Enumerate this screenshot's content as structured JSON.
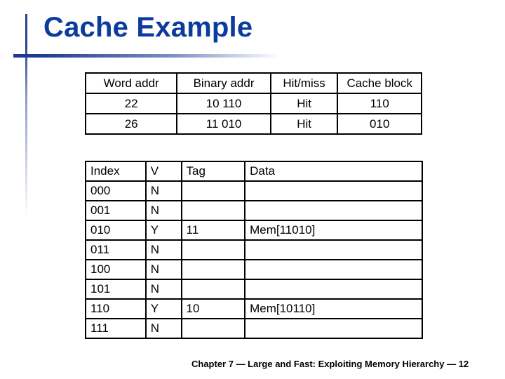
{
  "slide": {
    "title": "Cache Example",
    "footer": "Chapter 7 — Large and Fast: Exploiting Memory Hierarchy — 12"
  },
  "access_table": {
    "headers": [
      "Word addr",
      "Binary addr",
      "Hit/miss",
      "Cache block"
    ],
    "rows": [
      [
        "22",
        "10 110",
        "Hit",
        "110"
      ],
      [
        "26",
        "11 010",
        "Hit",
        "010"
      ]
    ]
  },
  "cache_table": {
    "headers": [
      "Index",
      "V",
      "Tag",
      "Data"
    ],
    "rows": [
      [
        "000",
        "N",
        "",
        ""
      ],
      [
        "001",
        "N",
        "",
        ""
      ],
      [
        "010",
        "Y",
        "11",
        "Mem[11010]"
      ],
      [
        "011",
        "N",
        "",
        ""
      ],
      [
        "100",
        "N",
        "",
        ""
      ],
      [
        "101",
        "N",
        "",
        ""
      ],
      [
        "110",
        "Y",
        "10",
        "Mem[10110]"
      ],
      [
        "111",
        "N",
        "",
        ""
      ]
    ]
  }
}
